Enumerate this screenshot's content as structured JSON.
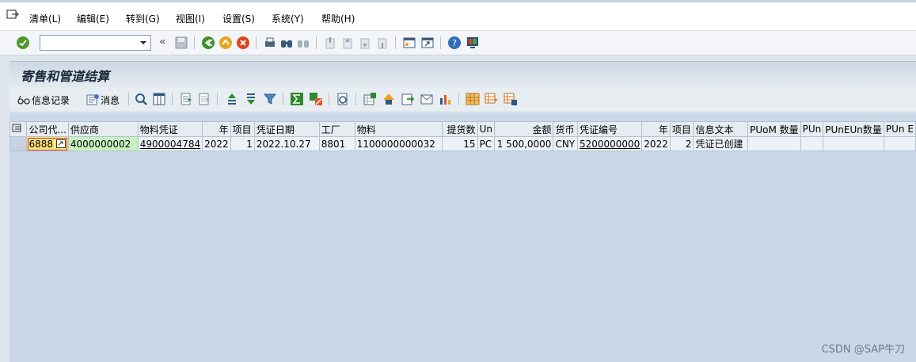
{
  "menu": [
    "清单(L)",
    "编辑(E)",
    "转到(G)",
    "视图(I)",
    "设置(S)",
    "系统(Y)",
    "帮助(H)"
  ],
  "toolbar": {
    "command_value": ""
  },
  "title": "寄售和管道结算",
  "app_toolbar": {
    "info_record_label": "信息记录",
    "message_label": "消息"
  },
  "table": {
    "columns": [
      "公司代...",
      "供应商",
      "物料凭证",
      "年",
      "项目",
      "凭证日期",
      "工厂",
      "物料",
      "提货数",
      "Un",
      "金额",
      "货币",
      "凭证编号",
      "年",
      "项目",
      "信息文本",
      "PUoM 数量",
      "PUn",
      "PUnEUn数量",
      "PUn E"
    ],
    "rows": [
      [
        "6888",
        "4000000002",
        "4900004784",
        "2022",
        "1",
        "2022.10.27",
        "8801",
        "1100000000032",
        "15",
        "PC",
        "1 500,0000",
        "CNY",
        "5200000000",
        "2022",
        "2",
        "凭证已创建",
        "",
        "",
        "",
        ""
      ]
    ]
  },
  "watermark": "CSDN @SAP牛刀",
  "colors": {
    "accent_green": "#4c9a2a",
    "selected_cell": "#ffe37a",
    "vendor_cell": "#c8f1bf"
  }
}
